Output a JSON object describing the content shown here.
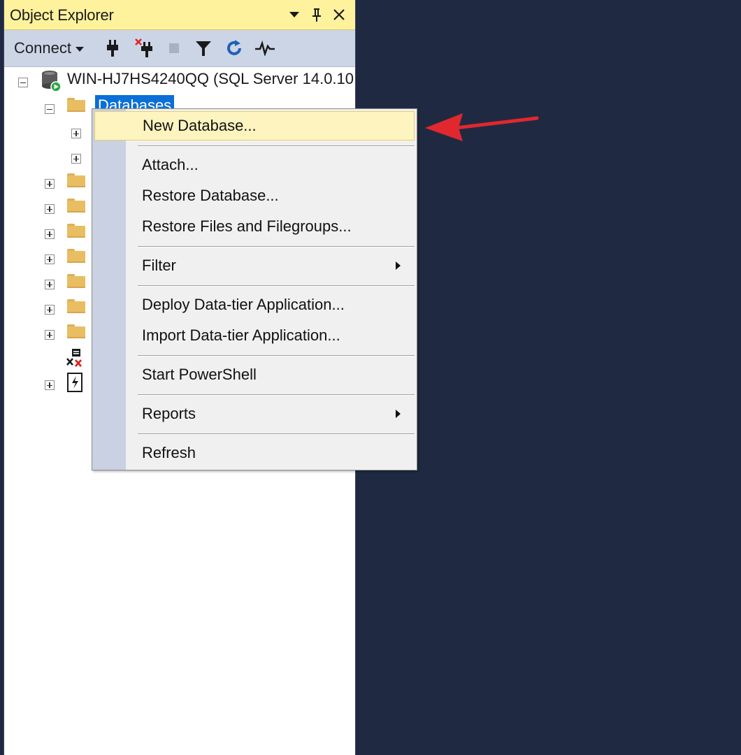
{
  "panel": {
    "title": "Object Explorer",
    "toolbar": {
      "connect_label": "Connect"
    }
  },
  "tree": {
    "server_label": "WIN-HJ7HS4240QQ (SQL Server 14.0.10",
    "databases_label": "Databases"
  },
  "context_menu": {
    "items": [
      {
        "label": "New Database...",
        "highlighted": true
      },
      {
        "label": "Attach..."
      },
      {
        "label": "Restore Database..."
      },
      {
        "label": "Restore Files and Filegroups..."
      },
      {
        "label": "Filter",
        "submenu": true
      },
      {
        "label": "Deploy Data-tier Application..."
      },
      {
        "label": "Import Data-tier Application..."
      },
      {
        "label": "Start PowerShell"
      },
      {
        "label": "Reports",
        "submenu": true
      },
      {
        "label": "Refresh"
      }
    ]
  },
  "colors": {
    "titlebar": "#fff29d",
    "toolbar": "#ccd5e6",
    "selection": "#0a6fd6",
    "menu_highlight": "#fdf4bf",
    "menu_gutter": "#c9d1e2",
    "background": "#1f2a42",
    "annotation_arrow": "#e0282e"
  },
  "icons": {
    "dropdown": "triangle-down-icon",
    "pin": "pin-icon",
    "close": "close-icon",
    "connect": "plug-icon",
    "disconnect": "disconnect-plug-icon",
    "stop": "stop-icon",
    "filter": "filter-icon",
    "refresh": "refresh-icon",
    "activity": "activity-monitor-icon",
    "server": "server-database-icon",
    "folder": "folder-icon"
  }
}
